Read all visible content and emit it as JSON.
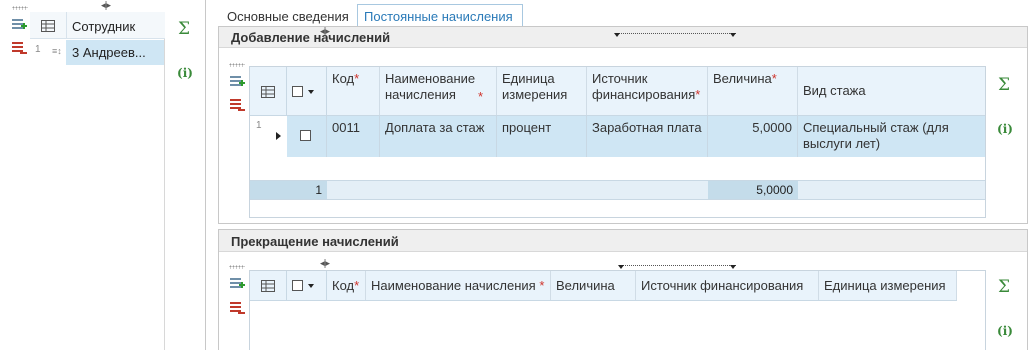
{
  "left_panel": {
    "header": "Сотрудник",
    "row_number": "1",
    "row_value": "3  Андреев..."
  },
  "tabs": [
    {
      "label": "Основные сведения",
      "active": false
    },
    {
      "label": "Постоянные начисления",
      "active": true
    }
  ],
  "add_section": {
    "title": "Добавление начислений",
    "columns": [
      {
        "label": "Код",
        "required": true
      },
      {
        "label": "Наименование начисления",
        "required": true
      },
      {
        "label": "Единица измерения",
        "required": false
      },
      {
        "label": "Источник финансирования",
        "required": true
      },
      {
        "label": "Величина",
        "required": true
      },
      {
        "label": "Вид стажа",
        "required": false
      }
    ],
    "rows": [
      {
        "row_number": "1",
        "code": "0011",
        "name": "Доплата за стаж",
        "unit": "процент",
        "source": "Заработная плата",
        "value": "5,0000",
        "seniority": "Специальный стаж (для выслуги лет)"
      }
    ],
    "footer": {
      "count": "1",
      "value_total": "5,0000"
    }
  },
  "stop_section": {
    "title": "Прекращение начислений",
    "columns": [
      {
        "label": "Код",
        "required": true
      },
      {
        "label": "Наименование начисления",
        "required": true
      },
      {
        "label": "Величина",
        "required": false
      },
      {
        "label": "Источник финансирования",
        "required": false
      },
      {
        "label": "Единица измерения",
        "required": false
      }
    ]
  },
  "icons": {
    "add_row": "add-row-icon",
    "delete_row": "delete-row-icon",
    "sum": "Σ",
    "info": "(i)",
    "grid_settings": "grid-settings-icon"
  },
  "colors": {
    "header_bg": "#e9f3fb",
    "selected_row": "#cfe6f4",
    "footer_bg": "#c4dcea",
    "section_header_bg": "#efefef",
    "accent_green": "#3a8a3a",
    "required_red": "#d0332b"
  }
}
